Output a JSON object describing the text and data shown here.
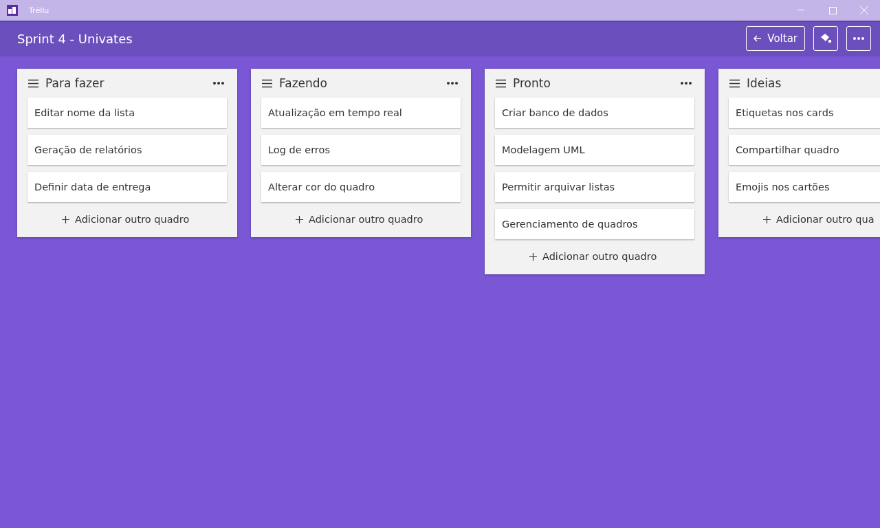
{
  "window": {
    "title": "Tréllu"
  },
  "board": {
    "title": "Sprint 4 - Univates",
    "back_button": "Voltar"
  },
  "lists": [
    {
      "title": "Para fazer",
      "cards": [
        "Editar nome da lista",
        "Geração de relatórios",
        "Definir data de entrega"
      ],
      "add_button": "Adicionar outro quadro"
    },
    {
      "title": "Fazendo",
      "cards": [
        "Atualização em tempo real",
        "Log de erros",
        "Alterar cor do quadro"
      ],
      "add_button": "Adicionar outro quadro"
    },
    {
      "title": "Pronto",
      "cards": [
        "Criar banco de dados",
        "Modelagem UML",
        "Permitir arquivar listas",
        "Gerenciamento de quadros"
      ],
      "add_button": "Adicionar outro quadro"
    },
    {
      "title": "Ideias",
      "cards": [
        "Etiquetas nos cards",
        "Compartilhar quadro",
        "Emojis nos cartões"
      ],
      "add_button": "Adicionar outro qua"
    }
  ]
}
